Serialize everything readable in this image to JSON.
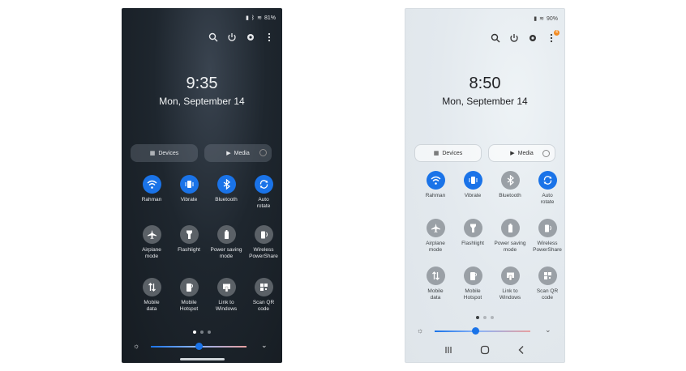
{
  "dark_phone": {
    "status": {
      "battery_text": "81%"
    },
    "clock": {
      "time": "9:35",
      "date": "Mon, September 14"
    },
    "pills": {
      "devices": "Devices",
      "media": "Media"
    },
    "tiles": [
      {
        "label": "Rahman",
        "icon": "wifi-icon",
        "state": "on"
      },
      {
        "label": "Vibrate",
        "icon": "vibrate-icon",
        "state": "on"
      },
      {
        "label": "Bluetooth",
        "icon": "bluetooth-icon",
        "state": "on"
      },
      {
        "label": "Auto\nrotate",
        "icon": "rotate-icon",
        "state": "on"
      },
      {
        "label": "Airplane\nmode",
        "icon": "airplane-icon",
        "state": "off"
      },
      {
        "label": "Flashlight",
        "icon": "flashlight-icon",
        "state": "off"
      },
      {
        "label": "Power saving\nmode",
        "icon": "battery-icon",
        "state": "off"
      },
      {
        "label": "Wireless\nPowerShare",
        "icon": "powershare-icon",
        "state": "off"
      },
      {
        "label": "Mobile\ndata",
        "icon": "mobile-data-icon",
        "state": "off"
      },
      {
        "label": "Mobile\nHotspot",
        "icon": "hotspot-icon",
        "state": "off"
      },
      {
        "label": "Link to\nWindows",
        "icon": "link-windows-icon",
        "state": "off"
      },
      {
        "label": "Scan QR\ncode",
        "icon": "qr-icon",
        "state": "off"
      }
    ],
    "page_dots": {
      "count": 3,
      "active_index": 0
    },
    "brightness_level": 0.5
  },
  "light_phone": {
    "status": {
      "battery_text": "90%"
    },
    "clock": {
      "time": "8:50",
      "date": "Mon, September 14"
    },
    "pills": {
      "devices": "Devices",
      "media": "Media"
    },
    "tiles": [
      {
        "label": "Rahman",
        "icon": "wifi-icon",
        "state": "on"
      },
      {
        "label": "Vibrate",
        "icon": "vibrate-icon",
        "state": "on"
      },
      {
        "label": "Bluetooth",
        "icon": "bluetooth-icon",
        "state": "off"
      },
      {
        "label": "Auto\nrotate",
        "icon": "rotate-icon",
        "state": "on"
      },
      {
        "label": "Airplane\nmode",
        "icon": "airplane-icon",
        "state": "off"
      },
      {
        "label": "Flashlight",
        "icon": "flashlight-icon",
        "state": "off"
      },
      {
        "label": "Power saving\nmode",
        "icon": "battery-icon",
        "state": "off"
      },
      {
        "label": "Wireless\nPowerShare",
        "icon": "powershare-icon",
        "state": "off"
      },
      {
        "label": "Mobile\ndata",
        "icon": "mobile-data-icon",
        "state": "off"
      },
      {
        "label": "Mobile\nHotspot",
        "icon": "hotspot-icon",
        "state": "off"
      },
      {
        "label": "Link to\nWindows",
        "icon": "link-windows-icon",
        "state": "off"
      },
      {
        "label": "Scan QR\ncode",
        "icon": "qr-icon",
        "state": "off"
      }
    ],
    "page_dots": {
      "count": 3,
      "active_index": 0
    },
    "brightness_level": 0.43,
    "notification_badge": "4"
  },
  "colors": {
    "accent": "#1a73e8",
    "tile_off_dark": "#5b6167",
    "tile_off_light": "#9aa0a6"
  }
}
